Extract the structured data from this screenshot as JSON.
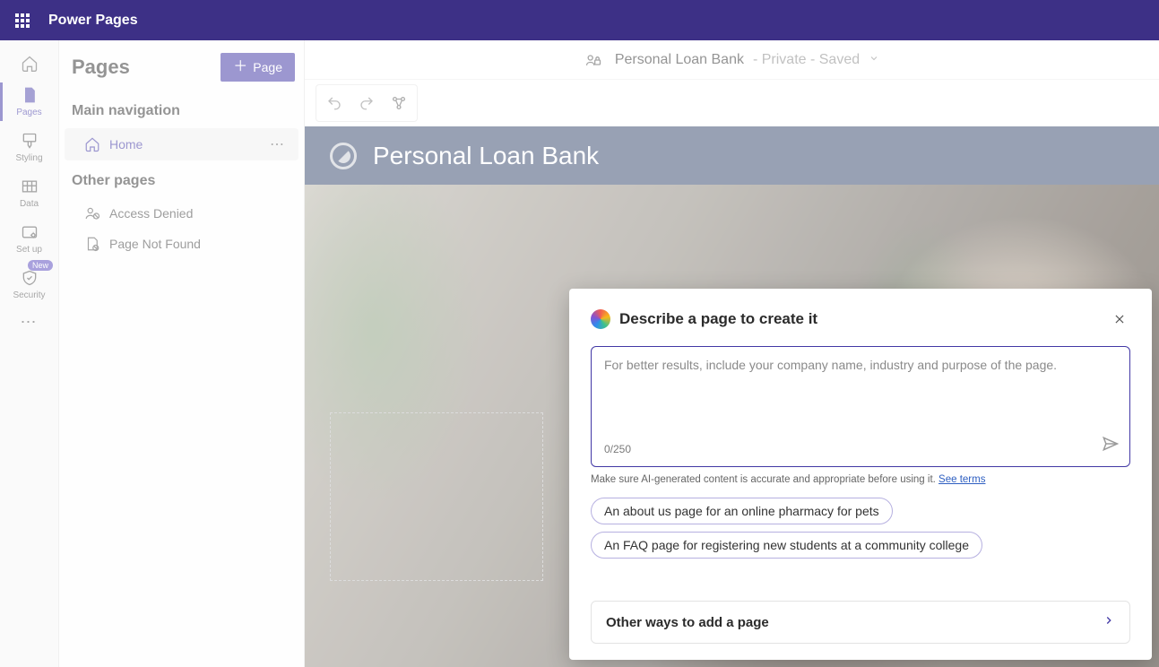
{
  "app": {
    "title": "Power Pages"
  },
  "rail": {
    "home_icon": "home-icon",
    "items": [
      {
        "label": "Pages",
        "icon": "page-icon",
        "active": true
      },
      {
        "label": "Styling",
        "icon": "brush-icon"
      },
      {
        "label": "Data",
        "icon": "table-icon"
      },
      {
        "label": "Set up",
        "icon": "gear-icon"
      },
      {
        "label": "Security",
        "icon": "shield-icon",
        "badge": "New"
      }
    ]
  },
  "pagesPanel": {
    "title": "Pages",
    "addButton": "Page",
    "mainNavLabel": "Main navigation",
    "homeLabel": "Home",
    "otherLabel": "Other pages",
    "otherPages": [
      {
        "label": "Access Denied",
        "icon": "person-denied-icon"
      },
      {
        "label": "Page Not Found",
        "icon": "page-missing-icon"
      }
    ]
  },
  "context": {
    "siteName": "Personal Loan Bank",
    "status": " - Private - Saved"
  },
  "siteHeader": {
    "title": "Personal Loan Bank"
  },
  "copilot": {
    "title": "Describe a page to create it",
    "placeholder": "For better results, include your company name, industry and purpose of the page.",
    "counter": "0/250",
    "disclaimer": "Make sure AI-generated content is accurate and appropriate before using it. ",
    "termsLink": "See terms",
    "suggestions": [
      "An about us page for an online pharmacy for pets",
      "An FAQ page for registering new students at a community college"
    ],
    "otherWays": "Other ways to add a page"
  }
}
